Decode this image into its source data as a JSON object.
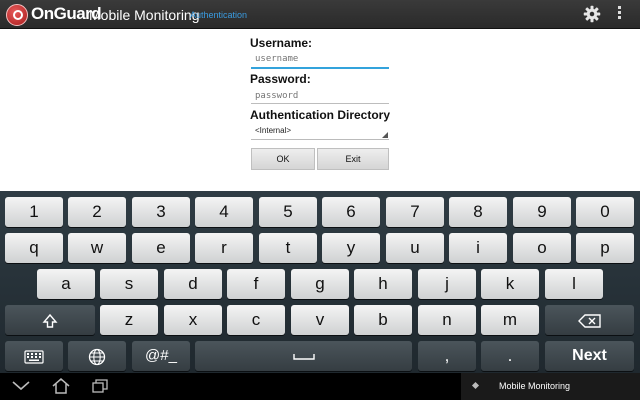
{
  "appbar": {
    "brand": "OnGuard",
    "brand_sub": "Mobile Monitoring",
    "screen": "Authentication",
    "icons": {
      "logo": "onguard-logo",
      "settings": "gear-icon",
      "overflow": "overflow-menu-icon"
    }
  },
  "form": {
    "username_label": "Username:",
    "username_placeholder": "username",
    "password_label": "Password:",
    "password_placeholder": "password",
    "auth_dir_label": "Authentication Directory",
    "auth_dir_value": "<Internal>",
    "ok_label": "OK",
    "exit_label": "Exit",
    "accent_color": "#3a9be0"
  },
  "keyboard": {
    "row1": [
      "1",
      "2",
      "3",
      "4",
      "5",
      "6",
      "7",
      "8",
      "9",
      "0"
    ],
    "row2": [
      "q",
      "w",
      "e",
      "r",
      "t",
      "y",
      "u",
      "i",
      "o",
      "p"
    ],
    "row3": [
      "a",
      "s",
      "d",
      "f",
      "g",
      "h",
      "j",
      "k",
      "l"
    ],
    "row4": [
      "z",
      "x",
      "c",
      "v",
      "b",
      "n",
      "m"
    ],
    "symbols_label": "@#_",
    "comma": ",",
    "period": ".",
    "next_label": "Next",
    "icons": {
      "shift": "shift-icon",
      "backspace": "backspace-icon",
      "keyboard": "keyboard-icon",
      "language": "globe-icon",
      "space": "space-bar-icon"
    }
  },
  "navbar": {
    "notification": "Mobile Monitoring",
    "icons": {
      "back": "back-icon",
      "home": "home-icon",
      "recent": "recent-apps-icon"
    }
  }
}
